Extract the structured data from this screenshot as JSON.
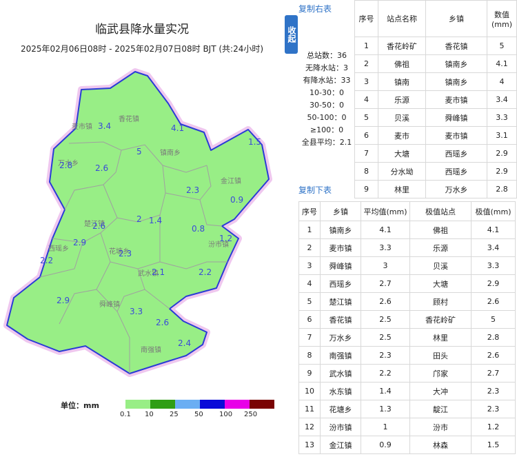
{
  "header": {
    "title": "临武县降水量实况",
    "subtitle": "2025年02月06日08时 - 2025年02月07日08时 BJT (共:24小时)"
  },
  "controls": {
    "collapse_label": "收起",
    "copy_right": "复制右表",
    "copy_below": "复制下表"
  },
  "stats": [
    "总站数：36",
    "无降水站：3",
    "有降水站：33",
    "10-30：0",
    "30-50：0",
    "50-100：0",
    "≥100：0",
    "全县平均：2.1"
  ],
  "station_table": {
    "headers": [
      "序号",
      "站点名称",
      "乡镇",
      "数值(mm)"
    ],
    "rows": [
      [
        "1",
        "香花岭矿",
        "香花镇",
        "5"
      ],
      [
        "2",
        "佛祖",
        "镇南乡",
        "4.1"
      ],
      [
        "3",
        "镇南",
        "镇南乡",
        "4"
      ],
      [
        "4",
        "乐源",
        "麦市镇",
        "3.4"
      ],
      [
        "5",
        "贝溪",
        "舜峰镇",
        "3.3"
      ],
      [
        "6",
        "麦市",
        "麦市镇",
        "3.1"
      ],
      [
        "7",
        "大塘",
        "西瑶乡",
        "2.9"
      ],
      [
        "8",
        "分水坳",
        "西瑶乡",
        "2.9"
      ],
      [
        "9",
        "林里",
        "万水乡",
        "2.8"
      ]
    ]
  },
  "town_table": {
    "headers": [
      "序号",
      "乡镇",
      "平均值(mm)",
      "极值站点",
      "极值(mm)"
    ],
    "rows": [
      [
        "1",
        "镇南乡",
        "4.1",
        "佛祖",
        "4.1"
      ],
      [
        "2",
        "麦市镇",
        "3.3",
        "乐源",
        "3.4"
      ],
      [
        "3",
        "舜峰镇",
        "3",
        "贝溪",
        "3.3"
      ],
      [
        "4",
        "西瑶乡",
        "2.7",
        "大塘",
        "2.9"
      ],
      [
        "5",
        "楚江镇",
        "2.6",
        "顾村",
        "2.6"
      ],
      [
        "6",
        "香花镇",
        "2.5",
        "香花岭矿",
        "5"
      ],
      [
        "7",
        "万水乡",
        "2.5",
        "林里",
        "2.8"
      ],
      [
        "8",
        "南强镇",
        "2.3",
        "田头",
        "2.6"
      ],
      [
        "9",
        "武水镇",
        "2.2",
        "邝家",
        "2.7"
      ],
      [
        "10",
        "水东镇",
        "1.4",
        "大冲",
        "2.3"
      ],
      [
        "11",
        "花塘乡",
        "1.3",
        "靛江",
        "2.3"
      ],
      [
        "12",
        "汾市镇",
        "1",
        "汾市",
        "1.2"
      ],
      [
        "13",
        "金江镇",
        "0.9",
        "林森",
        "1.5"
      ]
    ]
  },
  "map": {
    "town_labels": [
      {
        "text": "香花镇"
      },
      {
        "text": "麦市镇"
      },
      {
        "text": "镇南乡"
      },
      {
        "text": "万水乡"
      },
      {
        "text": "金江镇"
      },
      {
        "text": "楚江镇"
      },
      {
        "text": "西瑶乡"
      },
      {
        "text": "花塘乡"
      },
      {
        "text": "汾市镇"
      },
      {
        "text": "武水镇"
      },
      {
        "text": "舜峰镇"
      },
      {
        "text": "南强镇"
      }
    ],
    "values": [
      {
        "text": "3.4"
      },
      {
        "text": "4.1"
      },
      {
        "text": "1.5"
      },
      {
        "text": "5"
      },
      {
        "text": "2.8"
      },
      {
        "text": "2.6"
      },
      {
        "text": "2.3"
      },
      {
        "text": "0.9"
      },
      {
        "text": "2"
      },
      {
        "text": "1.4"
      },
      {
        "text": "2.6"
      },
      {
        "text": "0.8"
      },
      {
        "text": "1.2"
      },
      {
        "text": "2.9"
      },
      {
        "text": "2.3"
      },
      {
        "text": "2.2"
      },
      {
        "text": "2.1"
      },
      {
        "text": "2.2"
      },
      {
        "text": "2.9"
      },
      {
        "text": "3.3"
      },
      {
        "text": "2.6"
      },
      {
        "text": "2.4"
      }
    ],
    "fill_color": "#98ee86",
    "border_color": "#2a3bd6",
    "halo_color": "#efc7ef"
  },
  "legend": {
    "label": "单位：mm",
    "swatches": [
      "#ffffff",
      "#98ee86",
      "#2f9e15",
      "#6aaef3",
      "#0a0ad8",
      "#e800e8",
      "#7a0404"
    ],
    "ticks": [
      "0.1",
      "10",
      "25",
      "50",
      "100",
      "250"
    ]
  }
}
